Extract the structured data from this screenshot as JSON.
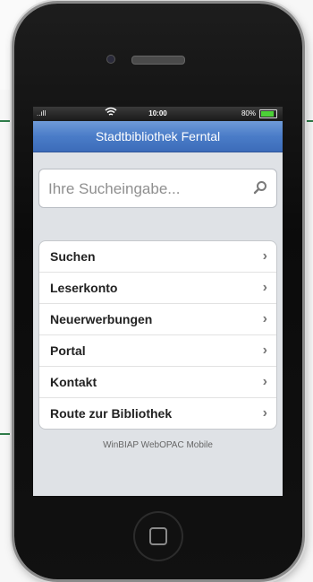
{
  "statusbar": {
    "signal": "..ıll",
    "time": "10:00",
    "battery_pct": "80%"
  },
  "app": {
    "title": "Stadtbibliothek Ferntal"
  },
  "search": {
    "placeholder": "Ihre Sucheingabe..."
  },
  "menu": {
    "items": [
      {
        "label": "Suchen"
      },
      {
        "label": "Leserkonto"
      },
      {
        "label": "Neuerwerbungen"
      },
      {
        "label": "Portal"
      },
      {
        "label": "Kontakt"
      },
      {
        "label": "Route zur Bibliothek"
      }
    ],
    "chevron": "›"
  },
  "footer": {
    "text": "WinBIAP WebOPAC Mobile"
  },
  "icons": {
    "search": "search-icon",
    "wifi": "wifi-icon",
    "battery": "battery-icon",
    "home": "home-button-icon"
  },
  "colors": {
    "title_bar": "#4a7cc8",
    "battery": "#4cd137"
  }
}
